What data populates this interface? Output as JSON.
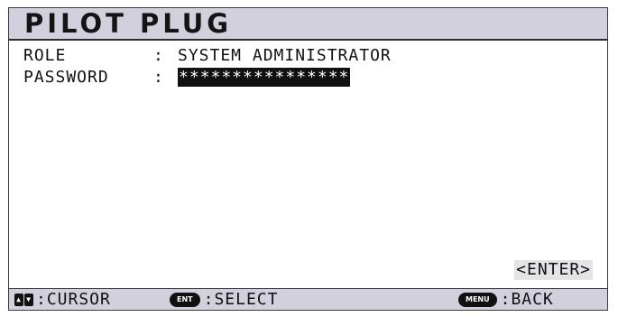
{
  "header": {
    "title": "PILOT PLUG"
  },
  "fields": [
    {
      "label": "ROLE",
      "sep": ":",
      "value": "SYSTEM ADMINISTRATOR"
    },
    {
      "label": "PASSWORD",
      "sep": ":",
      "value": "****************"
    }
  ],
  "actions": {
    "enter_label": "<ENTER>"
  },
  "footer": {
    "cursor": {
      "icon": "up-down-arrows-icon",
      "text": ":CURSOR"
    },
    "select": {
      "icon_label": "ENT",
      "text": ":SELECT"
    },
    "back": {
      "icon_label": "MENU",
      "text": ":BACK"
    }
  }
}
